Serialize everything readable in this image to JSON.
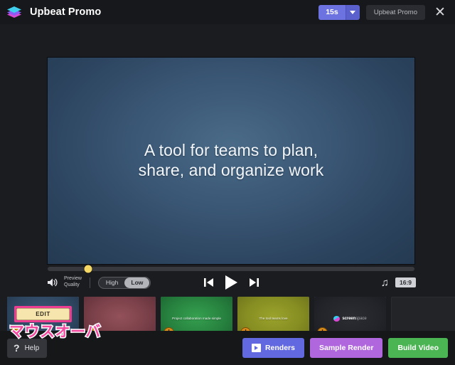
{
  "titlebar": {
    "logo_icon": "layers-icon",
    "app_title": "Upbeat Promo",
    "duration": "15s",
    "duration_caret_icon": "chevron-down-icon",
    "project_chip": "Upbeat Promo",
    "close_icon": "✕"
  },
  "preview": {
    "slide_text_line1": "A tool for teams to plan,",
    "slide_text_line2": "share, and organize work",
    "scrubber_position_percent": 11
  },
  "transport": {
    "volume_icon": "speaker-icon",
    "preview_quality_line1": "Preview",
    "preview_quality_line2": "Quality",
    "quality_high": "High",
    "quality_low": "Low",
    "quality_selected": "Low",
    "prev_icon": "skip-previous-icon",
    "play_icon": "play-icon",
    "next_icon": "skip-next-icon",
    "music_icon": "♫",
    "aspect_ratio": "16:9"
  },
  "thumbnails": [
    {
      "name": "scene-1",
      "kind": "edit",
      "label": "",
      "edit_label": "EDIT",
      "warning_icon": "!",
      "selected": true,
      "highlighted": true
    },
    {
      "name": "scene-2",
      "kind": "plain",
      "label": "",
      "warning_icon": "!",
      "selected": false
    },
    {
      "name": "scene-3",
      "kind": "text",
      "label": "Project collaboration made simple",
      "warning_icon": "!",
      "selected": false
    },
    {
      "name": "scene-4",
      "kind": "text",
      "label": "The tool teams love",
      "warning_icon": "!",
      "selected": false
    },
    {
      "name": "scene-5",
      "kind": "logo",
      "logo_bold": "screen",
      "logo_light": "space",
      "warning_icon": "!",
      "selected": false
    },
    {
      "name": "scene-empty",
      "kind": "empty",
      "label": "",
      "selected": false
    }
  ],
  "annotation": {
    "text": "マウスオーバ",
    "color": "#f24ba0"
  },
  "footer": {
    "help_icon": "?",
    "help_label": "Help",
    "renders_icon": "video-play-icon",
    "renders_label": "Renders",
    "sample_label": "Sample Render",
    "build_label": "Build Video"
  },
  "colors": {
    "accent_purple": "#6c72e0",
    "sample_purple": "#b067dd",
    "build_green": "#4cb553",
    "highlight_pink": "#ec3d93",
    "warn_orange": "#d88b1a",
    "scrub_yellow": "#f5d763"
  }
}
